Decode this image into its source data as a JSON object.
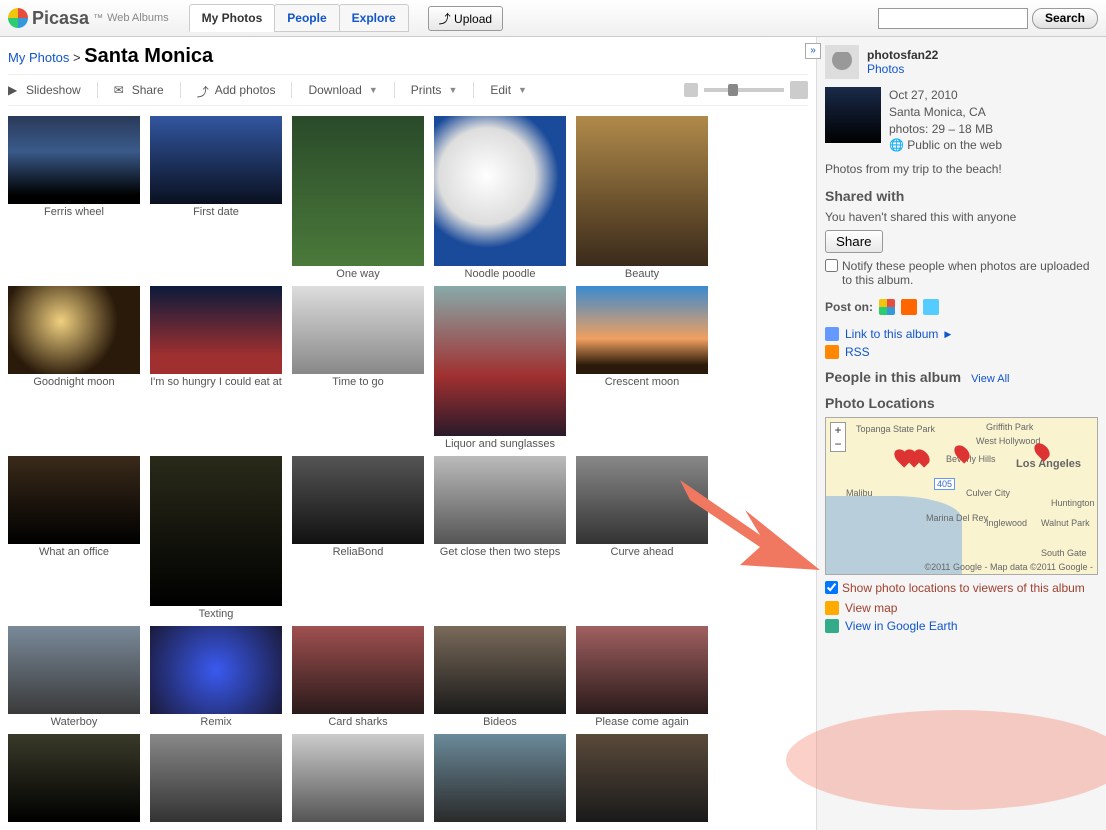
{
  "brand": {
    "name": "Picasa",
    "suffix": "™",
    "sub": "Web Albums"
  },
  "nav": {
    "my_photos": "My Photos",
    "people": "People",
    "explore": "Explore"
  },
  "upload_label": "Upload",
  "search": {
    "placeholder": "",
    "button": "Search"
  },
  "breadcrumb": {
    "root": "My Photos",
    "sep": ">",
    "title": "Santa Monica"
  },
  "toolbar": {
    "slideshow": "Slideshow",
    "share": "Share",
    "add_photos": "Add photos",
    "download": "Download",
    "prints": "Prints",
    "edit": "Edit"
  },
  "thumbs": [
    {
      "caption": "Ferris wheel",
      "tall": false,
      "bg": "linear-gradient(#2a3a5a 0%,#3a5a8a 40%,#000 90%)"
    },
    {
      "caption": "First date",
      "tall": false,
      "bg": "linear-gradient(#3256a0,#0a1020)"
    },
    {
      "caption": "One way",
      "tall": true,
      "bg": "linear-gradient(#2a4a2a,#4a7a3a)"
    },
    {
      "caption": "Noodle poodle",
      "tall": true,
      "bg": "radial-gradient(circle at 40% 40%,#fff,#ddd 40%,#1a4a9a 60%)"
    },
    {
      "caption": "Beauty",
      "tall": true,
      "bg": "linear-gradient(#b08a4a,#3a2a1a)"
    },
    {
      "caption": "Goodnight moon",
      "tall": false,
      "bg": "radial-gradient(circle at 40% 40%,#f0d080,#2a1a0a 60%)"
    },
    {
      "caption": "I'm so hungry I could eat at",
      "tall": false,
      "bg": "linear-gradient(#0a1a3a,#a03030 80%)"
    },
    {
      "caption": "Time to go",
      "tall": false,
      "bg": "linear-gradient(#ddd,#888)"
    },
    {
      "caption": "Liquor and sunglasses",
      "tall": true,
      "bg": "linear-gradient(#8aa,#a03030 60%,#2a1a2a)"
    },
    {
      "caption": "Crescent moon",
      "tall": false,
      "bg": "linear-gradient(#3a8ad0 0%,#f0a060 60%,#2a1a0a 90%)"
    },
    {
      "caption": "What an office",
      "tall": false,
      "bg": "linear-gradient(#3a2a1a,#000)"
    },
    {
      "caption": "Texting",
      "tall": true,
      "bg": "linear-gradient(#2a2a1a,#000)"
    },
    {
      "caption": "ReliaBond",
      "tall": false,
      "bg": "linear-gradient(#555,#111)"
    },
    {
      "caption": "Get close then two steps",
      "tall": false,
      "bg": "linear-gradient(#bbb,#555)"
    },
    {
      "caption": "Curve ahead",
      "tall": false,
      "bg": "linear-gradient(#888,#333)"
    },
    {
      "caption": "Waterboy",
      "tall": false,
      "bg": "linear-gradient(#7a8a9a,#3a3a3a)"
    },
    {
      "caption": "Remix",
      "tall": false,
      "bg": "radial-gradient(circle,#3a5af0,#1a1a3a)"
    },
    {
      "caption": "Card sharks",
      "tall": false,
      "bg": "linear-gradient(#a05050,#2a1a1a)"
    },
    {
      "caption": "Bideos",
      "tall": false,
      "bg": "linear-gradient(#7a6a5a,#1a1a1a)"
    },
    {
      "caption": "Please come again",
      "tall": false,
      "bg": "linear-gradient(#a06060,#2a1a1a)"
    },
    {
      "caption": "",
      "tall": false,
      "bg": "linear-gradient(#3a3a2a,#000)"
    },
    {
      "caption": "",
      "tall": false,
      "bg": "linear-gradient(#888,#333)"
    },
    {
      "caption": "",
      "tall": false,
      "bg": "linear-gradient(#ccc,#555)"
    },
    {
      "caption": "",
      "tall": false,
      "bg": "linear-gradient(#6a8a9a,#2a2a2a)"
    },
    {
      "caption": "",
      "tall": false,
      "bg": "linear-gradient(#5a4a3a,#1a1a1a)"
    }
  ],
  "sidebar": {
    "toggle": "»",
    "user": {
      "name": "photosfan22",
      "photos_link": "Photos"
    },
    "album": {
      "date": "Oct 27, 2010",
      "location": "Santa Monica, CA",
      "stats": "photos: 29 – 18 MB",
      "visibility": "Public on the web"
    },
    "caption": "Photos from my trip to the beach!",
    "shared_h": "Shared with",
    "shared_none": "You haven't shared this with anyone",
    "share_btn": "Share",
    "notify": "Notify these people when photos are uploaded to this album.",
    "post_on": "Post on:",
    "link_album": "Link to this album",
    "rss": "RSS",
    "people_h": "People in this album",
    "view_all": "View All",
    "locations_h": "Photo Locations",
    "map": {
      "attrib": "©2011 Google - Map data ©2011 Google - ",
      "cities": [
        "Topanga State Park",
        "Griffith Park",
        "West Hollywood",
        "Beverly Hills",
        "Los Angeles",
        "Culver City",
        "Inglewood",
        "Marina Del Rey",
        "Huntington Park",
        "Walnut Park",
        "South Gate",
        "Malibu"
      ],
      "roads": [
        "405"
      ],
      "zoom_plus": "+",
      "zoom_minus": "−"
    },
    "show_locations": "Show photo locations to viewers of this album",
    "view_map": "View map",
    "view_earth": "View in Google Earth"
  }
}
